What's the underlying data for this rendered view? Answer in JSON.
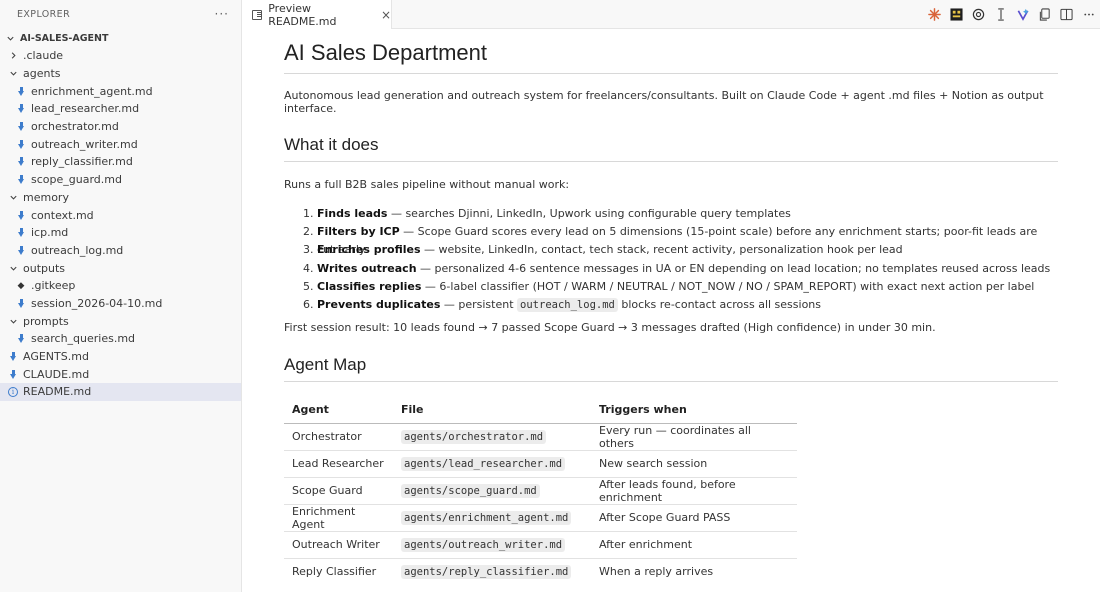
{
  "explorer": {
    "title": "EXPLORER",
    "more": "···",
    "root": "AI-SALES-AGENT",
    "items": [
      {
        "label": ".claude",
        "type": "folder",
        "open": false,
        "depth": 1
      },
      {
        "label": "agents",
        "type": "folder",
        "open": true,
        "depth": 1
      },
      {
        "label": "enrichment_agent.md",
        "type": "md",
        "depth": 2
      },
      {
        "label": "lead_researcher.md",
        "type": "md",
        "depth": 2
      },
      {
        "label": "orchestrator.md",
        "type": "md",
        "depth": 2
      },
      {
        "label": "outreach_writer.md",
        "type": "md",
        "depth": 2
      },
      {
        "label": "reply_classifier.md",
        "type": "md",
        "depth": 2
      },
      {
        "label": "scope_guard.md",
        "type": "md",
        "depth": 2
      },
      {
        "label": "memory",
        "type": "folder",
        "open": true,
        "depth": 1
      },
      {
        "label": "context.md",
        "type": "md",
        "depth": 2
      },
      {
        "label": "icp.md",
        "type": "md",
        "depth": 2
      },
      {
        "label": "outreach_log.md",
        "type": "md",
        "depth": 2
      },
      {
        "label": "outputs",
        "type": "folder",
        "open": true,
        "depth": 1
      },
      {
        "label": ".gitkeep",
        "type": "git",
        "depth": 2
      },
      {
        "label": "session_2026-04-10.md",
        "type": "md",
        "depth": 2
      },
      {
        "label": "prompts",
        "type": "folder",
        "open": true,
        "depth": 1
      },
      {
        "label": "search_queries.md",
        "type": "md",
        "depth": 2
      },
      {
        "label": "AGENTS.md",
        "type": "md",
        "depth": 1
      },
      {
        "label": "CLAUDE.md",
        "type": "md",
        "depth": 1
      },
      {
        "label": "README.md",
        "type": "info",
        "depth": 1,
        "selected": true
      }
    ]
  },
  "tab": {
    "label": "Preview README.md",
    "close": "×"
  },
  "toolbar_icons": [
    "claude-icon",
    "terminal-icon",
    "openai-icon",
    "text-cursor-icon",
    "ai-sparkle-icon",
    "copy-icon",
    "split-editor-icon",
    "more-icon"
  ],
  "doc": {
    "title": "AI Sales Department",
    "intro": "Autonomous lead generation and outreach system for freelancers/consultants. Built on Claude Code + agent .md files + Notion as output interface.",
    "what_heading": "What it does",
    "runs": "Runs a full B2B sales pipeline without manual work:",
    "steps": [
      {
        "bold": "Finds leads",
        "text": " — searches Djinni, LinkedIn, Upwork using configurable query templates"
      },
      {
        "bold": "Filters by ICP",
        "text": " — Scope Guard scores every lead on 5 dimensions (15-point scale) before any enrichment starts; poor-fit leads are cut early"
      },
      {
        "bold": "Enriches profiles",
        "text": " — website, LinkedIn, contact, tech stack, recent activity, personalization hook per lead"
      },
      {
        "bold": "Writes outreach",
        "text": " — personalized 4-6 sentence messages in UA or EN depending on lead location; no templates reused across leads"
      },
      {
        "bold": "Classifies replies",
        "text": " — 6-label classifier (HOT / WARM / NEUTRAL / NOT_NOW / NO / SPAM_REPORT) with exact next action per label"
      },
      {
        "bold": "Prevents duplicates",
        "text": " — persistent ",
        "code": "outreach_log.md",
        "after": " blocks re-contact across all sessions"
      }
    ],
    "result": "First session result: 10 leads found → 7 passed Scope Guard → 3 messages drafted (High confidence) in under 30 min.",
    "map_heading": "Agent Map",
    "table": {
      "headers": [
        "Agent",
        "File",
        "Triggers when"
      ],
      "rows": [
        [
          "Orchestrator",
          "agents/orchestrator.md",
          "Every run — coordinates all others"
        ],
        [
          "Lead Researcher",
          "agents/lead_researcher.md",
          "New search session"
        ],
        [
          "Scope Guard",
          "agents/scope_guard.md",
          "After leads found, before enrichment"
        ],
        [
          "Enrichment Agent",
          "agents/enrichment_agent.md",
          "After Scope Guard PASS"
        ],
        [
          "Outreach Writer",
          "agents/outreach_writer.md",
          "After enrichment"
        ],
        [
          "Reply Classifier",
          "agents/reply_classifier.md",
          "When a reply arrives"
        ]
      ]
    }
  }
}
